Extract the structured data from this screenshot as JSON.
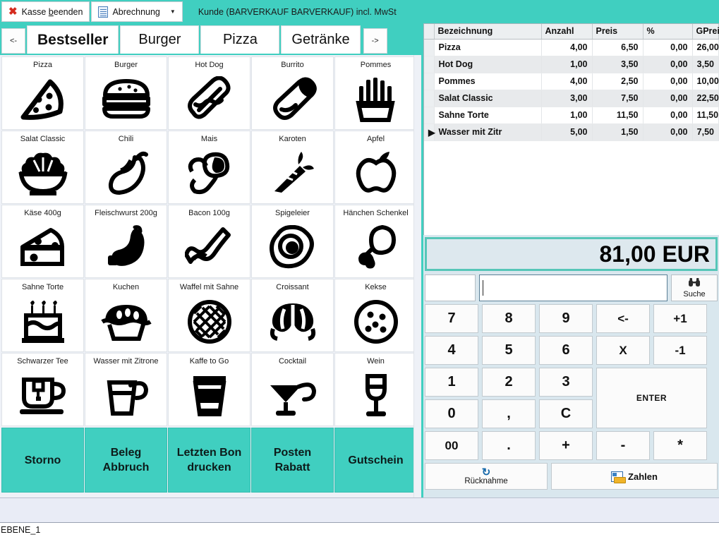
{
  "window": {
    "accent_teal": "#40cfc0",
    "panel_bg": "#d9e7ee",
    "status_text": "EBENE_1"
  },
  "toolbar": {
    "close_button": "Kasse beenden",
    "close_button_pre": "Kasse ",
    "close_button_underlined": "b",
    "close_button_post": "eenden",
    "billing_button": "Abrechnung",
    "billing_caret": "▼",
    "customer_label": "Kunde (BARVERKAUF BARVERKAUF) incl. MwSt"
  },
  "tabs": {
    "prev_arrow": "<-",
    "next_arrow": "->",
    "items": [
      {
        "label": "Bestseller",
        "active": true
      },
      {
        "label": "Burger",
        "active": false
      },
      {
        "label": "Pizza",
        "active": false
      },
      {
        "label": "Getränke",
        "active": false
      }
    ]
  },
  "product_grid": {
    "rows": [
      [
        {
          "label": "Pizza",
          "icon": "pizza-slice-icon"
        },
        {
          "label": "Burger",
          "icon": "burger-icon"
        },
        {
          "label": "Hot Dog",
          "icon": "hotdog-icon"
        },
        {
          "label": "Burrito",
          "icon": "burrito-icon"
        },
        {
          "label": "Pommes",
          "icon": "fries-icon"
        }
      ],
      [
        {
          "label": "Salat Classic",
          "icon": "salad-bowl-icon"
        },
        {
          "label": "Chili",
          "icon": "chili-pepper-icon"
        },
        {
          "label": "Mais",
          "icon": "corn-icon"
        },
        {
          "label": "Karoten",
          "icon": "carrot-icon"
        },
        {
          "label": "Apfel",
          "icon": "apple-icon"
        }
      ],
      [
        {
          "label": "Käse 400g",
          "icon": "cheese-wedge-icon"
        },
        {
          "label": "Fleischwurst 200g",
          "icon": "sausage-icon"
        },
        {
          "label": "Bacon 100g",
          "icon": "bacon-icon"
        },
        {
          "label": "Spigeleier",
          "icon": "fried-egg-icon"
        },
        {
          "label": "Hänchen Schenkel",
          "icon": "chicken-leg-icon"
        }
      ],
      [
        {
          "label": "Sahne Torte",
          "icon": "birthday-cake-icon"
        },
        {
          "label": "Kuchen",
          "icon": "pie-icon"
        },
        {
          "label": "Waffel mit Sahne",
          "icon": "waffle-icon"
        },
        {
          "label": "Croissant",
          "icon": "croissant-icon"
        },
        {
          "label": "Kekse",
          "icon": "cookie-icon"
        }
      ],
      [
        {
          "label": "Schwarzer Tee",
          "icon": "tea-cup-icon"
        },
        {
          "label": "Wasser mit Zitrone",
          "icon": "water-glass-icon"
        },
        {
          "label": "Kaffe to Go",
          "icon": "coffee-cup-icon"
        },
        {
          "label": "Cocktail",
          "icon": "cocktail-glass-icon"
        },
        {
          "label": "Wein",
          "icon": "wine-glass-icon"
        }
      ]
    ],
    "actions": [
      {
        "label": "Storno"
      },
      {
        "label": "Beleg\nAbbruch",
        "line1": "Beleg",
        "line2": "Abbruch"
      },
      {
        "label": "Letzten Bon\ndrucken",
        "line1": "Letzten Bon",
        "line2": "drucken"
      },
      {
        "label": "Posten\nRabatt",
        "line1": "Posten",
        "line2": "Rabatt"
      },
      {
        "label": "Gutschein"
      }
    ]
  },
  "receipt": {
    "columns": [
      "Bezeichnung",
      "Anzahl",
      "Preis",
      "%",
      "GPreis"
    ],
    "rows": [
      {
        "marker": "",
        "name": "Pizza",
        "qty": "4,00",
        "price": "6,50",
        "pct": "0,00",
        "total": "26,00"
      },
      {
        "marker": "",
        "name": "Hot Dog",
        "qty": "1,00",
        "price": "3,50",
        "pct": "0,00",
        "total": "3,50"
      },
      {
        "marker": "",
        "name": "Pommes",
        "qty": "4,00",
        "price": "2,50",
        "pct": "0,00",
        "total": "10,00"
      },
      {
        "marker": "",
        "name": "Salat Classic",
        "qty": "3,00",
        "price": "7,50",
        "pct": "0,00",
        "total": "22,50"
      },
      {
        "marker": "",
        "name": "Sahne Torte",
        "qty": "1,00",
        "price": "11,50",
        "pct": "0,00",
        "total": "11,50"
      },
      {
        "marker": "▶",
        "name": "Wasser mit Zitr",
        "qty": "5,00",
        "price": "1,50",
        "pct": "0,00",
        "total": "7,50"
      }
    ]
  },
  "total": {
    "value": "81,00 EUR"
  },
  "keypad": {
    "quantity_value": "",
    "search_value": "",
    "search_button_label": "Suche",
    "search_icon": "binoculars-icon",
    "rows": [
      [
        "7",
        "8",
        "9",
        "<-",
        "+1"
      ],
      [
        "4",
        "5",
        "6",
        "X",
        "-1"
      ],
      [
        "1",
        "2",
        "3"
      ],
      [
        "0",
        ",",
        "C"
      ],
      [
        "00",
        ".",
        "+",
        "-",
        "*"
      ]
    ],
    "enter_label": "ENTER",
    "return_label": "Rücknahme",
    "return_icon": "refresh-icon",
    "pay_label": "Zahlen",
    "pay_icon": "payment-icon"
  }
}
